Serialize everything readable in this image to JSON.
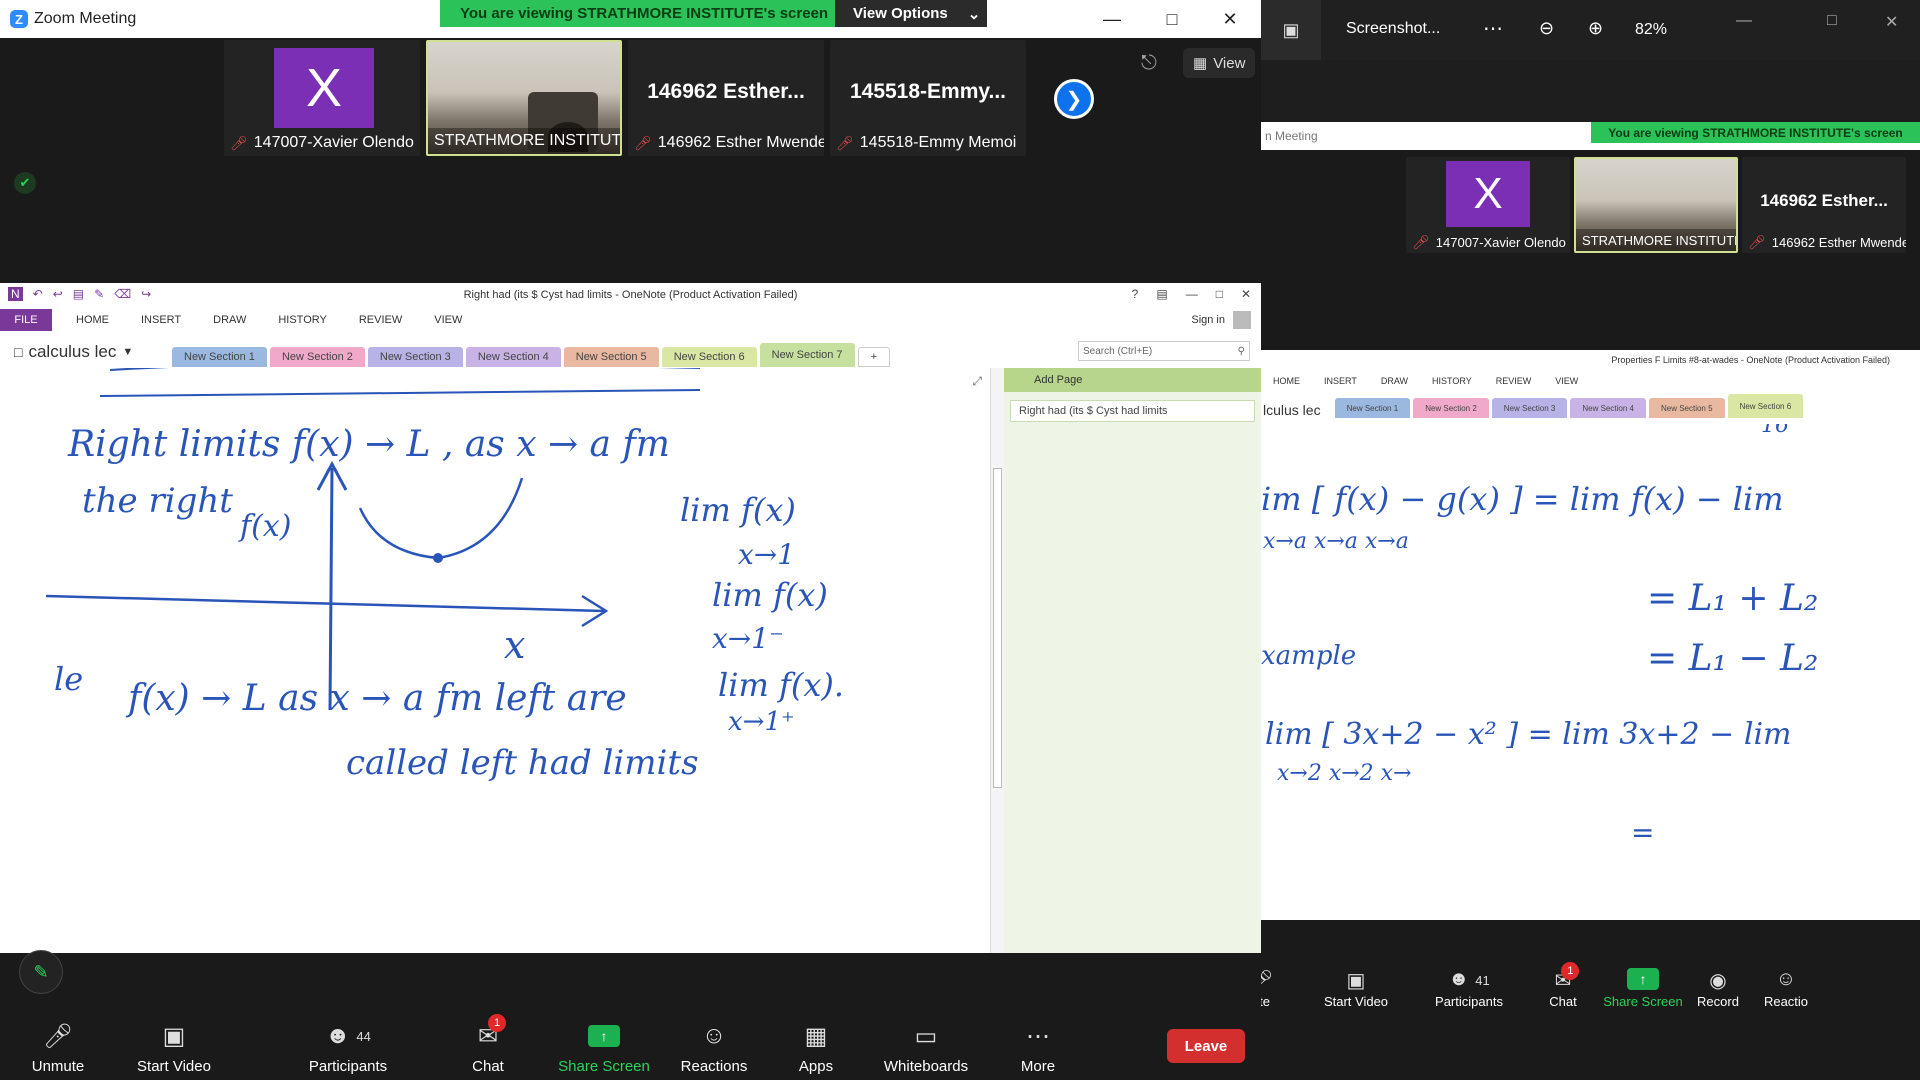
{
  "left": {
    "title": "Zoom Meeting",
    "banner": "You are viewing STRATHMORE INSTITUTE's screen",
    "view_options": "View Options",
    "view_button": "View",
    "participants": [
      {
        "name": "147007-Xavier Olendo",
        "avatar_letter": "X",
        "muted": true
      },
      {
        "name": "STRATHMORE INSTITUTE",
        "video": true,
        "muted": false
      },
      {
        "name": "146962 Esther Mwende",
        "display": "146962  Esther...",
        "muted": true
      },
      {
        "name": "145518-Emmy Memoi",
        "display": "145518-Emmy...",
        "muted": true
      }
    ],
    "onenote": {
      "title": "Right had (its $ Cyst had limits - OneNote (Product Activation Failed)",
      "ribbon": [
        "FILE",
        "HOME",
        "INSERT",
        "DRAW",
        "HISTORY",
        "REVIEW",
        "VIEW"
      ],
      "sign_in": "Sign in",
      "notebook": "calculus  lec",
      "sections": [
        "New Section 1",
        "New Section 2",
        "New Section 3",
        "New Section 4",
        "New Section 5",
        "New Section 6",
        "New Section 7"
      ],
      "section_colors": [
        "#9bb8e0",
        "#f0a9c8",
        "#b8b3e6",
        "#c9b3e6",
        "#e8b9a0",
        "#d9e6a4",
        "#c6e0a0"
      ],
      "add_tab": "+",
      "search_placeholder": "Search (Ctrl+E)",
      "add_page": "Add Page",
      "page_item": "Right had (its $ Cyst had limits",
      "ink": {
        "l1": "Right limits   f(x) → L , as x → a fm",
        "l2": "the right",
        "fx": "f(x)",
        "lim1": "lim  f(x)",
        "lim1b": "x→1",
        "lim2": "lim  f(x)",
        "lim2b": "x→1⁻",
        "lim3": "lim   f(x).",
        "lim3b": "x→1⁺",
        "xaxis": "x",
        "l3": "f(x) → L  as  x → a fm  left  are",
        "l4": "called   left  had  limits",
        "le": "le"
      }
    },
    "controls": [
      {
        "label": "Unmute",
        "icon": "mic-off"
      },
      {
        "label": "Start Video",
        "icon": "camera-off"
      },
      {
        "label": "Participants",
        "icon": "people",
        "count": "44"
      },
      {
        "label": "Chat",
        "icon": "chat",
        "badge": "1"
      },
      {
        "label": "Share Screen",
        "icon": "share"
      },
      {
        "label": "Reactions",
        "icon": "emoji"
      },
      {
        "label": "Apps",
        "icon": "apps"
      },
      {
        "label": "Whiteboards",
        "icon": "whiteboard"
      },
      {
        "label": "More",
        "icon": "more"
      }
    ],
    "leave": "Leave"
  },
  "right": {
    "title": "Screenshot...",
    "zoom_level": "82%",
    "meeting_label": "n Meeting",
    "banner": "You are viewing STRATHMORE INSTITUTE's screen",
    "participants": [
      {
        "name": "147007-Xavier Olendo",
        "avatar_letter": "X"
      },
      {
        "name": "STRATHMORE INSTITUTE"
      },
      {
        "name": "146962 Esther Mwende",
        "display": "146962  Esther..."
      }
    ],
    "onenote": {
      "title": "Properties F Limits #8-at-wades - OneNote (Product Activation Failed)",
      "ribbon": [
        "HOME",
        "INSERT",
        "DRAW",
        "HISTORY",
        "REVIEW",
        "VIEW"
      ],
      "notebook": "lculus  lec",
      "sections": [
        "New Section 1",
        "New Section 2",
        "New Section 3",
        "New Section 4",
        "New Section 5",
        "New Section 6"
      ],
      "section_colors": [
        "#9bb8e0",
        "#f0a9c8",
        "#b8b3e6",
        "#c9b3e6",
        "#e8b9a0",
        "#d9e6a4"
      ],
      "ink": {
        "top": "16",
        "l1": "im   [ f(x) − g(x) ]  =  lim  f(x) −  lim",
        "l1b": "x→a                               x→a                x→a",
        "l2": "= L₁ + L₂",
        "l3": "= L₁ − L₂",
        "ex": "xample",
        "l4": "lim [ 3x+2  − x² ]  =  lim  3x+2 −  lim",
        "l4b": "x→2                                x→2                x→",
        "l5": "="
      }
    },
    "controls": [
      {
        "label": "ute",
        "icon": "mic-off"
      },
      {
        "label": "Start Video",
        "icon": "camera-off"
      },
      {
        "label": "Participants",
        "icon": "people",
        "count": "41"
      },
      {
        "label": "Chat",
        "icon": "chat",
        "badge": "1"
      },
      {
        "label": "Share Screen",
        "icon": "share"
      },
      {
        "label": "Record",
        "icon": "record"
      },
      {
        "label": "Reactio",
        "icon": "emoji"
      }
    ]
  }
}
